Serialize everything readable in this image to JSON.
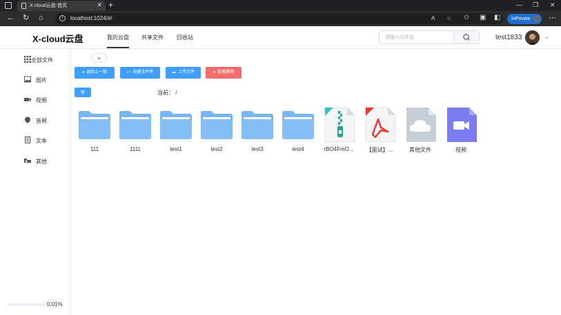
{
  "browser": {
    "tab_title": "X-cloud云盘-首页",
    "tab_close": "✕",
    "new_tab": "+",
    "url": "localhost:1024/#/",
    "inprivate_label": "InPrivate",
    "window_controls": [
      "—",
      "❐",
      "✕"
    ]
  },
  "header": {
    "logo": "X-cloud云盘",
    "nav": [
      {
        "label": "我的云盘",
        "active": true
      },
      {
        "label": "共享文件",
        "active": false
      },
      {
        "label": "回收站",
        "active": false
      }
    ],
    "search_placeholder": "请输入文件名",
    "username": "test1833"
  },
  "sidebar": {
    "items": [
      {
        "label": "全部文件",
        "icon": "grid-icon"
      },
      {
        "label": "图片",
        "icon": "image-icon"
      },
      {
        "label": "视频",
        "icon": "video-icon"
      },
      {
        "label": "音频",
        "icon": "audio-icon"
      },
      {
        "label": "文本",
        "icon": "document-icon"
      },
      {
        "label": "其他",
        "icon": "other-icon"
      }
    ],
    "storage_percent": 0.0001,
    "storage_label": "0.01%"
  },
  "toolbar": {
    "collapse_symbol": "«",
    "back_label": "返回上一级",
    "create_folder_label": "创建文件夹",
    "upload_label": "上传文件",
    "batch_delete_label": "批量删除"
  },
  "path": {
    "label": "当前：",
    "value": "/"
  },
  "files": [
    {
      "name": "111",
      "type": "folder"
    },
    {
      "name": "1111",
      "type": "folder"
    },
    {
      "name": "test1",
      "type": "folder"
    },
    {
      "name": "test2",
      "type": "folder"
    },
    {
      "name": "test3",
      "type": "folder"
    },
    {
      "name": "test4",
      "type": "folder"
    },
    {
      "name": "rBO4FmO...",
      "type": "zip"
    },
    {
      "name": "【面试】...",
      "type": "pdf"
    },
    {
      "name": "其他文件",
      "type": "cloud"
    },
    {
      "name": "视频",
      "type": "video"
    }
  ],
  "colors": {
    "primary": "#409eff",
    "danger": "#f56c6c",
    "folder": "#79b6f5",
    "video_tile": "#7b7cf0",
    "cloud_tile": "#c5ced6"
  }
}
